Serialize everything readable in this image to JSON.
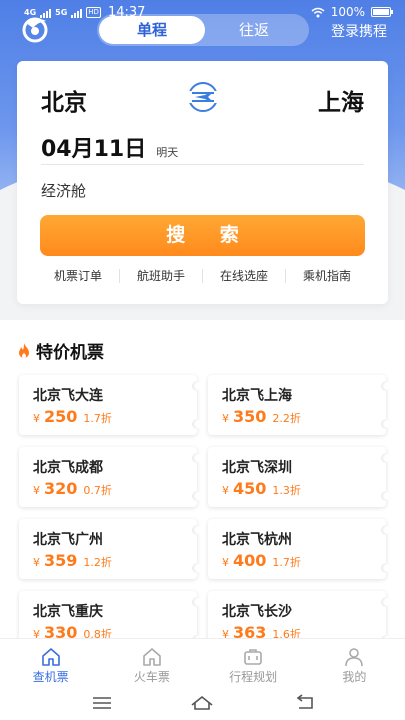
{
  "status": {
    "time": "14:37",
    "battery": "100%",
    "net_4g": "4G",
    "net_5g": "5G",
    "hd": "HD"
  },
  "header": {
    "trip_oneway": "单程",
    "trip_round": "往返",
    "login": "登录携程"
  },
  "search": {
    "from_city": "北京",
    "to_city": "上海",
    "date": "04月11日",
    "date_relative": "明天",
    "cabin": "经济舱",
    "search_label": "搜 索",
    "quick_links": [
      "机票订单",
      "航班助手",
      "在线选座",
      "乘机指南"
    ]
  },
  "deals": {
    "title": "特价机票",
    "currency": "¥",
    "items": [
      {
        "route": "北京飞大连",
        "price": "250",
        "discount": "1.7折"
      },
      {
        "route": "北京飞上海",
        "price": "350",
        "discount": "2.2折"
      },
      {
        "route": "北京飞成都",
        "price": "320",
        "discount": "0.7折"
      },
      {
        "route": "北京飞深圳",
        "price": "450",
        "discount": "1.3折"
      },
      {
        "route": "北京飞广州",
        "price": "359",
        "discount": "1.2折"
      },
      {
        "route": "北京飞杭州",
        "price": "400",
        "discount": "1.7折"
      },
      {
        "route": "北京飞重庆",
        "price": "330",
        "discount": "0.8折"
      },
      {
        "route": "北京飞长沙",
        "price": "363",
        "discount": "1.6折"
      }
    ]
  },
  "tabs": [
    {
      "label": "查机票",
      "icon": "home-icon",
      "active": true
    },
    {
      "label": "火车票",
      "icon": "train-icon",
      "active": false
    },
    {
      "label": "行程规划",
      "icon": "suitcase-icon",
      "active": false
    },
    {
      "label": "我的",
      "icon": "user-icon",
      "active": false
    }
  ],
  "colors": {
    "primary": "#3a6fe0",
    "accent": "#ff8a1c",
    "price": "#ff7a1a"
  }
}
